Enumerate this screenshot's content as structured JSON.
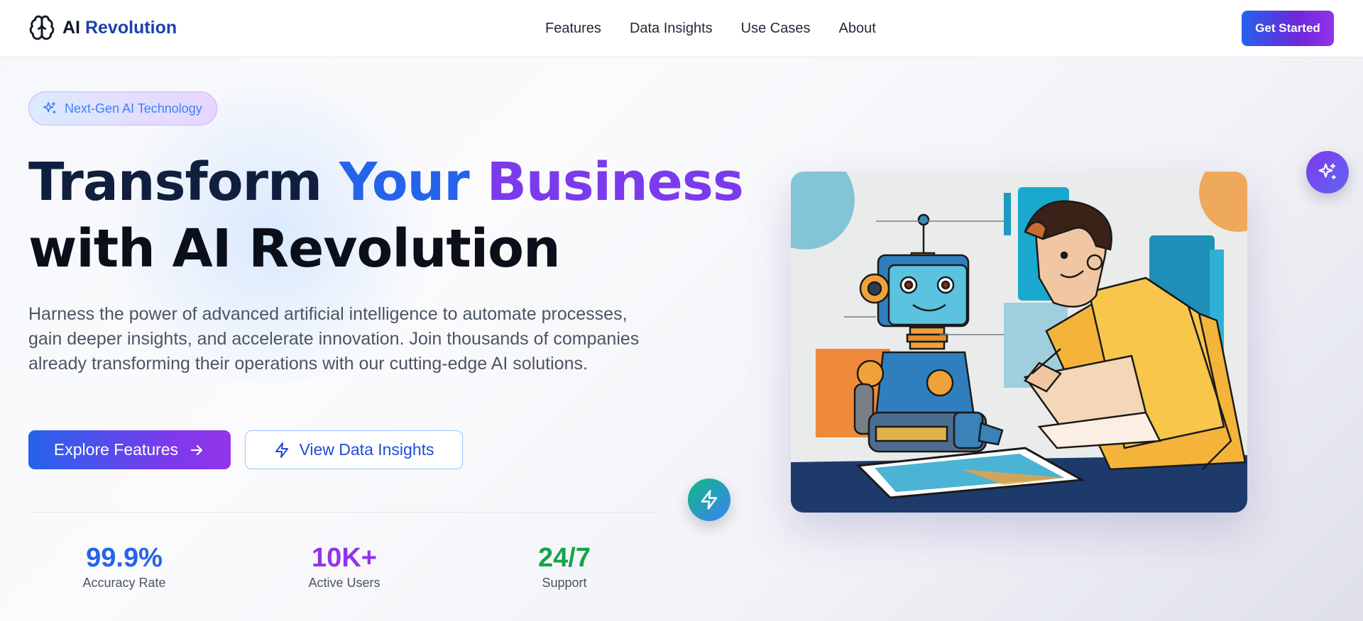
{
  "header": {
    "logo_prefix": "AI",
    "logo_accent": "Revolution",
    "nav": [
      {
        "label": "Features"
      },
      {
        "label": "Data Insights"
      },
      {
        "label": "Use Cases"
      },
      {
        "label": "About"
      }
    ],
    "cta_label": "Get Started"
  },
  "hero": {
    "badge": "Next-Gen AI Technology",
    "headline_word1": "Transform",
    "headline_word2": "Your",
    "headline_word3": "Business",
    "headline_line2": "with AI Revolution",
    "description": "Harness the power of advanced artificial intelligence to automate processes, gain deeper insights, and accelerate innovation. Join thousands of companies already transforming their operations with our cutting-edge AI solutions.",
    "primary_button": "Explore Features",
    "secondary_button": "View Data Insights"
  },
  "stats": [
    {
      "value": "99.9%",
      "label": "Accuracy Rate",
      "color": "#2563eb"
    },
    {
      "value": "10K+",
      "label": "Active Users",
      "color": "#9333ea"
    },
    {
      "value": "24/7",
      "label": "Support",
      "color": "#16a34a"
    }
  ],
  "icons": {
    "logo": "brain-icon",
    "badge": "sparkles-icon",
    "primary_button": "arrow-right-icon",
    "secondary_button": "lightning-icon",
    "floating_top": "sparkles-icon",
    "floating_bottom": "lightning-icon"
  },
  "colors": {
    "brand_blue": "#2563eb",
    "brand_purple": "#7c3aed",
    "gradient_end": "#9333ea"
  }
}
